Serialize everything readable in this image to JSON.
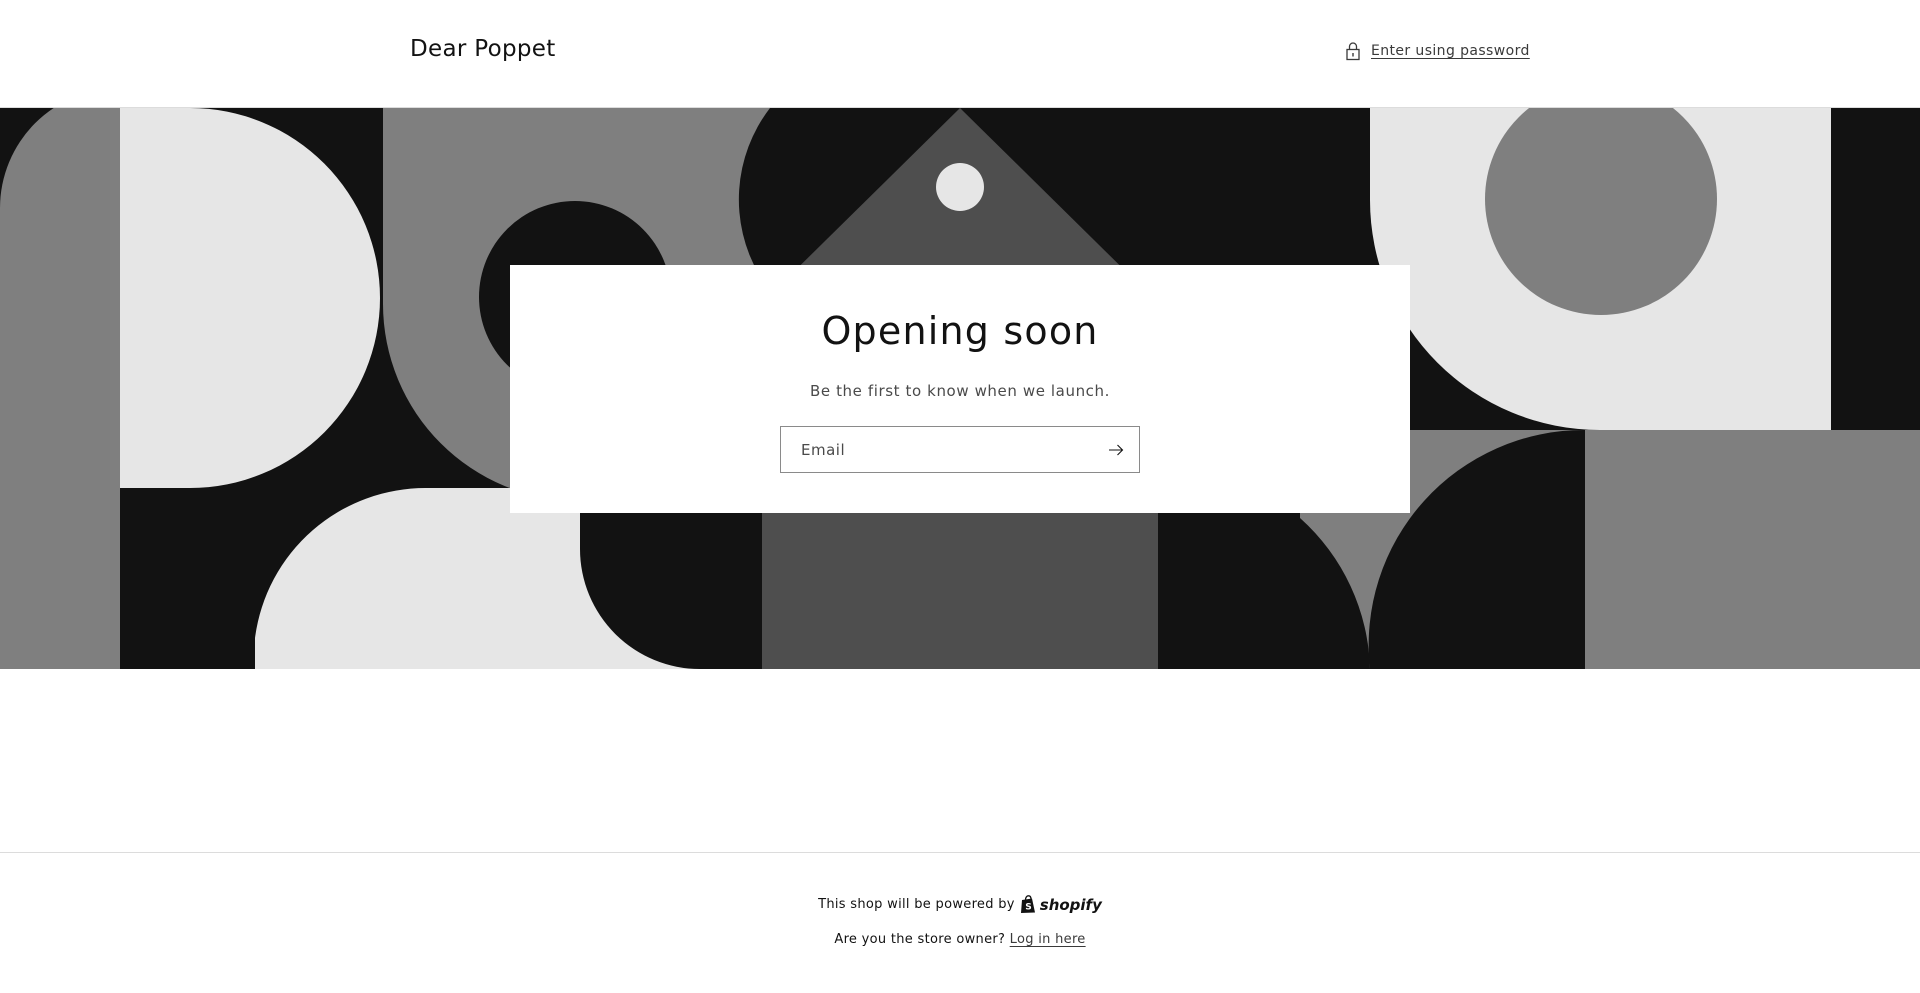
{
  "header": {
    "store_name": "Dear Poppet",
    "password_link": "Enter using password",
    "password_icon": "lock-icon"
  },
  "banner": {
    "palette": {
      "black": "#121212",
      "dark": "#4e4e4e",
      "mid": "#7f7f7f",
      "light": "#e6e6e6"
    }
  },
  "card": {
    "title": "Opening soon",
    "subtitle": "Be the first to know when we launch.",
    "email_placeholder": "Email",
    "submit_icon": "arrow-right-icon"
  },
  "footer": {
    "powered_text": "This shop will be powered by",
    "shopify_wordmark": "shopify",
    "owner_text": "Are you the store owner?",
    "login_link": "Log in here"
  }
}
